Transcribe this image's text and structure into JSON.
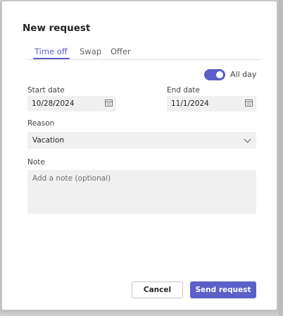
{
  "dialog": {
    "title": "New request"
  },
  "tabs": [
    {
      "label": "Time off",
      "active": true
    },
    {
      "label": "Swap",
      "active": false
    },
    {
      "label": "Offer",
      "active": false
    }
  ],
  "all_day": {
    "label": "All day",
    "on": true
  },
  "start_date": {
    "label": "Start date",
    "value": "10/28/2024",
    "icon": "calendar-icon"
  },
  "end_date": {
    "label": "End date",
    "value": "11/1/2024",
    "icon": "calendar-icon"
  },
  "reason": {
    "label": "Reason",
    "value": "Vacation",
    "icon": "chevron-down-icon"
  },
  "note": {
    "label": "Note",
    "placeholder": "Add a note (optional)",
    "value": ""
  },
  "actions": {
    "cancel_label": "Cancel",
    "send_label": "Send request"
  },
  "colors": {
    "accent": "#5b5fc7",
    "field_background": "#f0f0f0",
    "text": "#242424"
  }
}
